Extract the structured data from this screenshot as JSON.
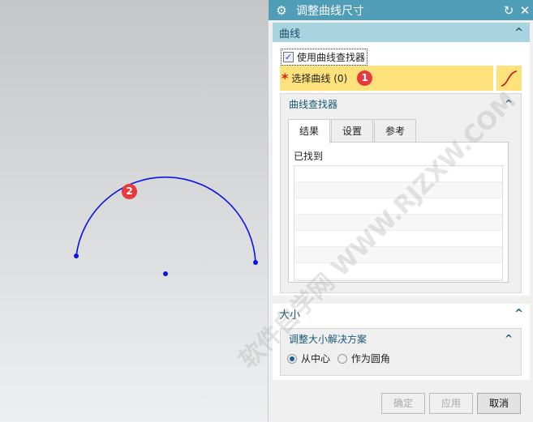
{
  "dialog": {
    "title": "调整曲线尺寸",
    "reset_icon": "reset-icon",
    "close_icon": "close-icon"
  },
  "curve_section": {
    "title": "曲线",
    "use_finder_label": "使用曲线查找器",
    "use_finder_checked": true,
    "select_label": "选择曲线 (0)",
    "badge": "1",
    "finder": {
      "title": "曲线查找器",
      "tabs": [
        "结果",
        "设置",
        "参考"
      ],
      "active_tab": 0,
      "found_label": "已找到"
    }
  },
  "size_section": {
    "title": "大小",
    "sub_title": "调整大小解决方案",
    "options": [
      "从中心",
      "作为圆角"
    ],
    "selected": 0
  },
  "buttons": {
    "ok": "确定",
    "apply": "应用",
    "cancel": "取消"
  },
  "canvas": {
    "badge": "2"
  },
  "watermark": "软件自学网 WWW.RJZXW.COM",
  "colors": {
    "title_bar": "#4f9db6",
    "section_header": "#a8d4df",
    "select_highlight": "#fde27c",
    "curve": "#0a14e6",
    "badge": "#e8393c"
  }
}
